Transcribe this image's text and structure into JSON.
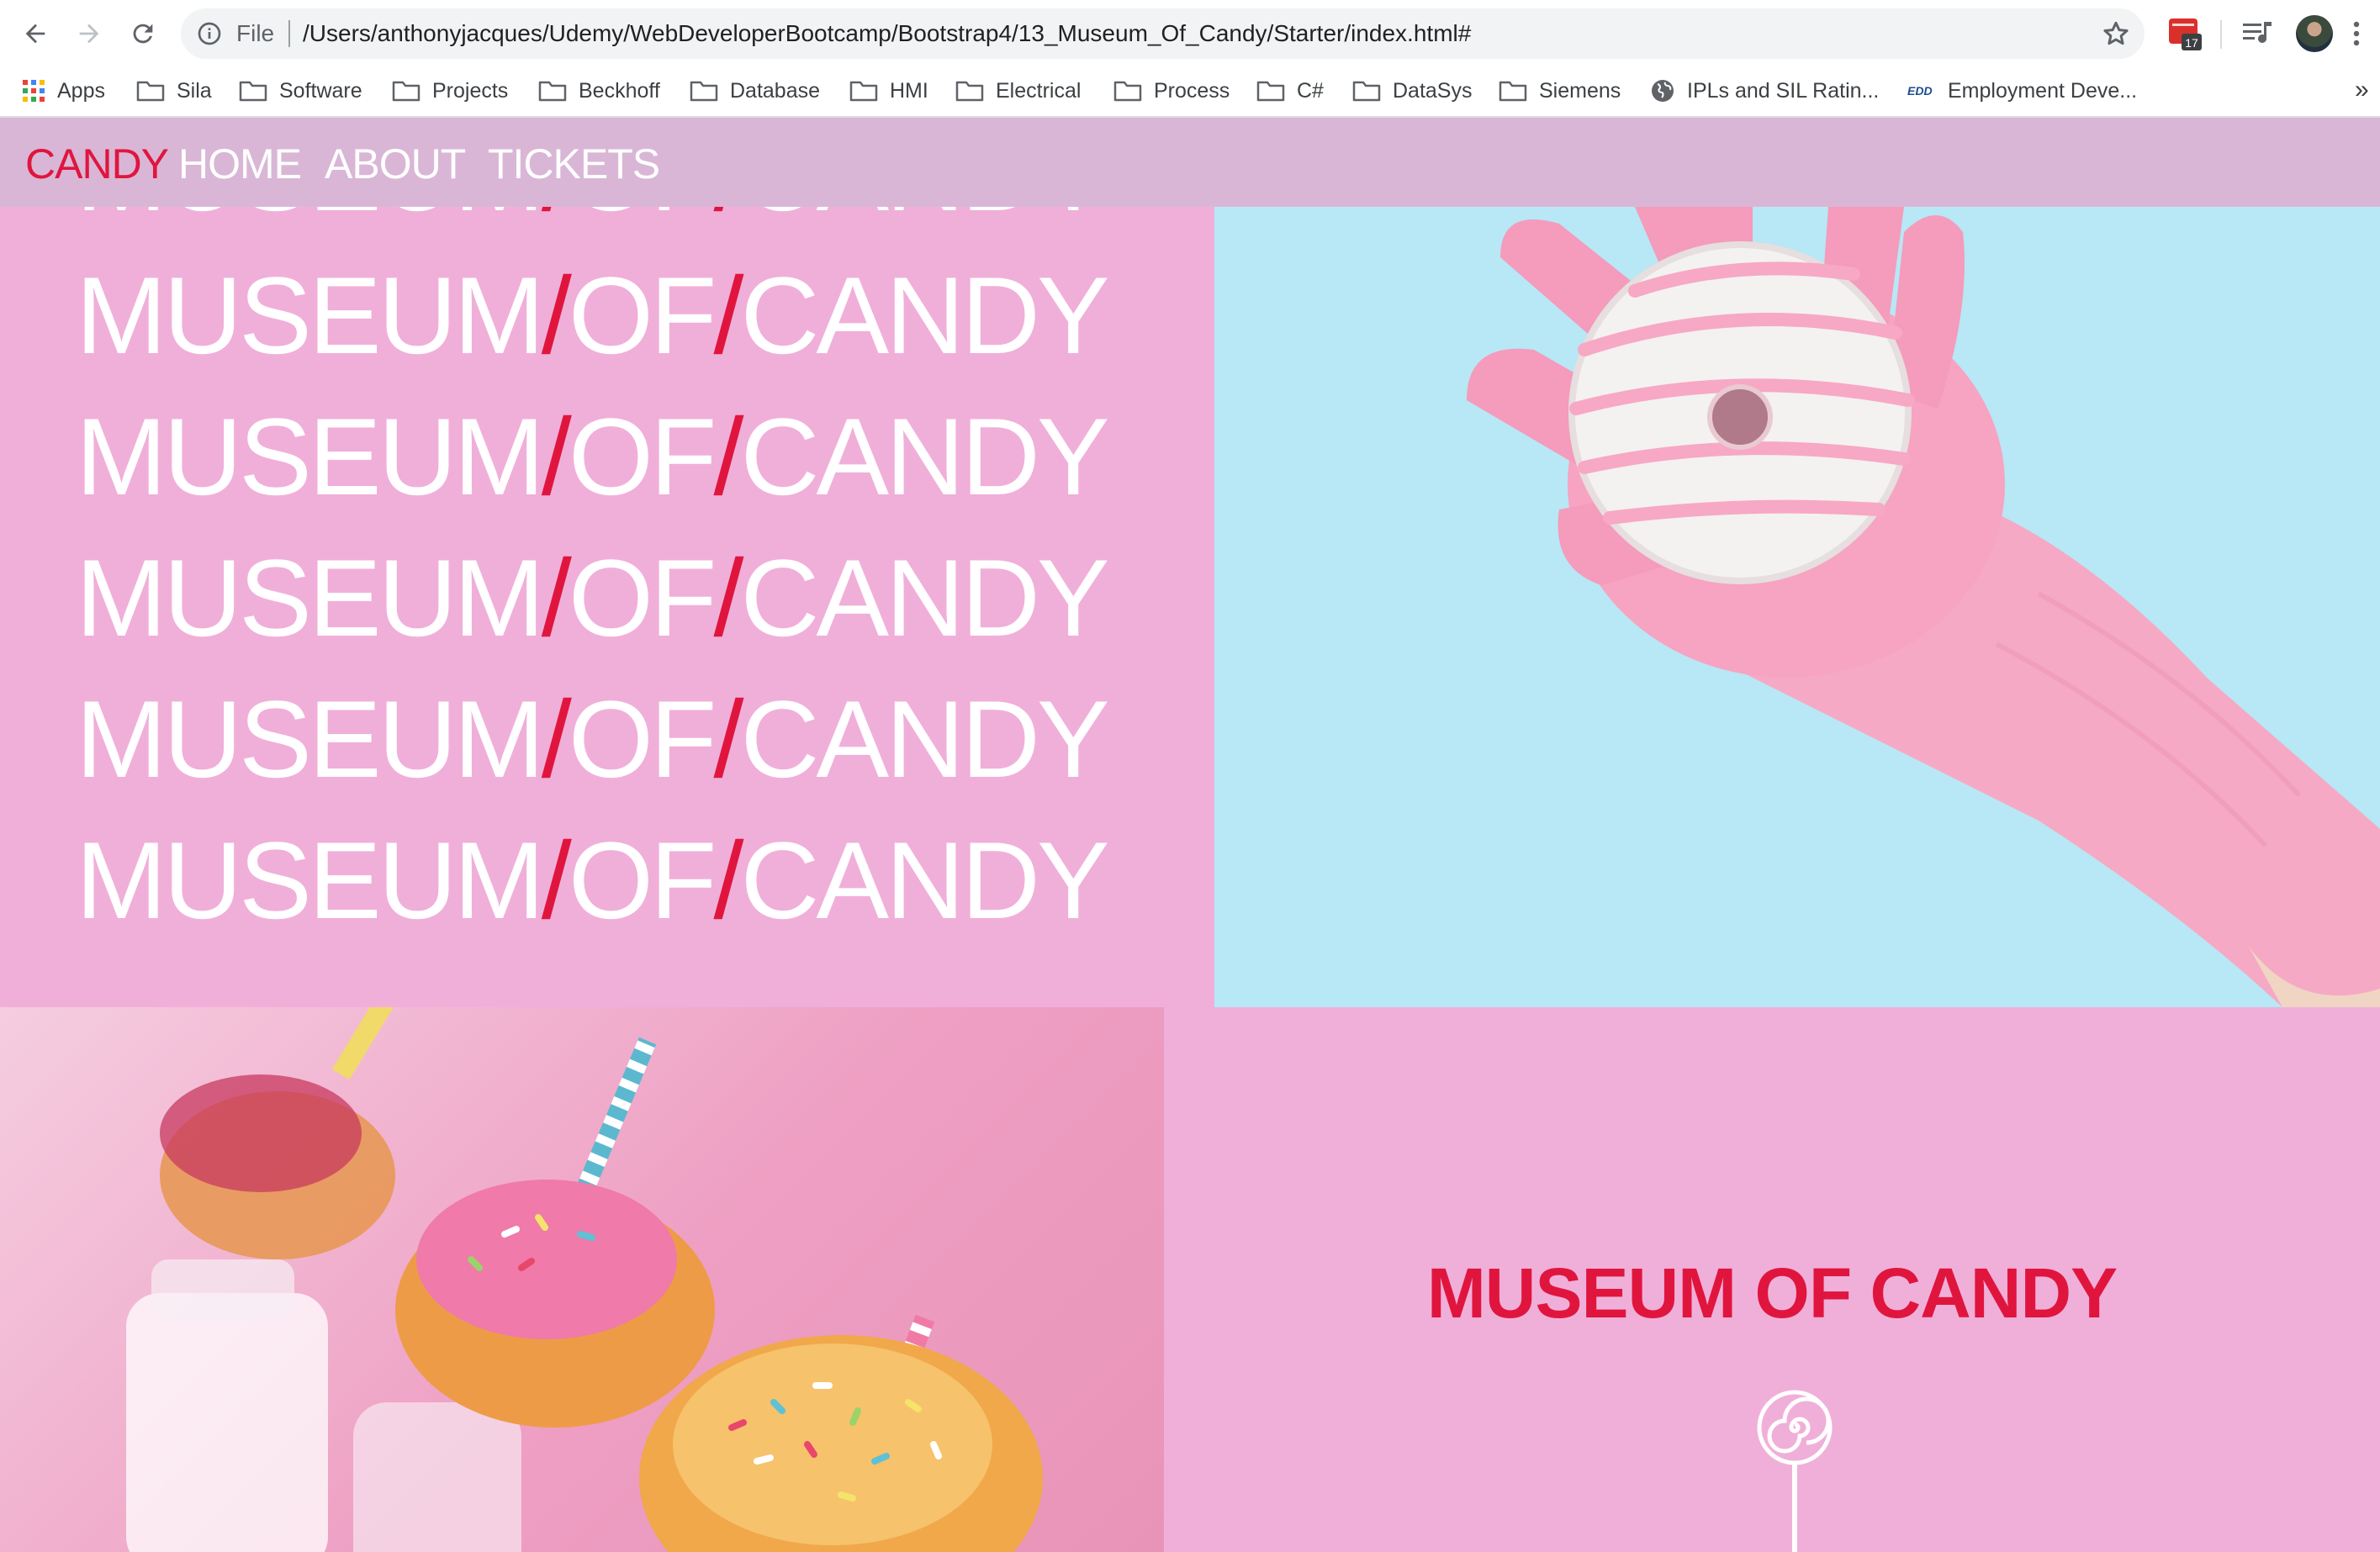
{
  "browser": {
    "file_label": "File",
    "url": "/Users/anthonyjacques/Udemy/WebDeveloperBootcamp/Bootstrap4/13_Museum_Of_Candy/Starter/index.html#",
    "extension_badge": "17",
    "bookmarks": [
      {
        "label": "Apps",
        "icon": "apps-grid-icon"
      },
      {
        "label": "Sila",
        "icon": "folder-icon"
      },
      {
        "label": "Software",
        "icon": "folder-icon"
      },
      {
        "label": "Projects",
        "icon": "folder-icon"
      },
      {
        "label": "Beckhoff",
        "icon": "folder-icon"
      },
      {
        "label": "Database",
        "icon": "folder-icon"
      },
      {
        "label": "HMI",
        "icon": "folder-icon"
      },
      {
        "label": "Electrical",
        "icon": "folder-icon"
      },
      {
        "label": "Process",
        "icon": "folder-icon"
      },
      {
        "label": "C#",
        "icon": "folder-icon"
      },
      {
        "label": "DataSys",
        "icon": "folder-icon"
      },
      {
        "label": "Siemens",
        "icon": "folder-icon"
      },
      {
        "label": "IPLs and SIL Ratin...",
        "icon": "globe-icon"
      },
      {
        "label": "Employment Deve...",
        "icon": "edd-logo-icon"
      }
    ],
    "more_label": "»"
  },
  "site": {
    "brand": "CANDY",
    "nav": [
      "HOME",
      "ABOUT",
      "TICKETS"
    ],
    "title_parts": [
      "MUSEUM",
      "/",
      "OF",
      "/",
      "CANDY"
    ],
    "heading": "MUSEUM OF CANDY"
  },
  "colors": {
    "accent_red": "#e0153e",
    "pink_bg": "#f0afd9",
    "nav_bg": "#d9b6d6",
    "sky_blue": "#b8e7f5"
  }
}
